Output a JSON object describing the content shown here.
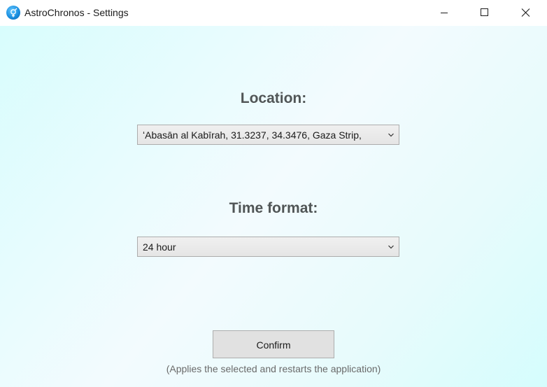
{
  "window": {
    "title": "AstroChronos - Settings",
    "icon": "astro-app-icon"
  },
  "location": {
    "heading": "Location:",
    "selected": "ʻAbasān al Kabīrah, 31.3237, 34.3476, Gaza Strip,"
  },
  "time_format": {
    "heading": "Time format:",
    "selected": "24 hour"
  },
  "confirm": {
    "label": "Confirm",
    "hint": "(Applies the selected and restarts the application)"
  },
  "colors": {
    "background_start": "#d8fdfd",
    "background_mid": "#f3fbfe",
    "heading": "#505556",
    "button": "#e1e1e1"
  }
}
